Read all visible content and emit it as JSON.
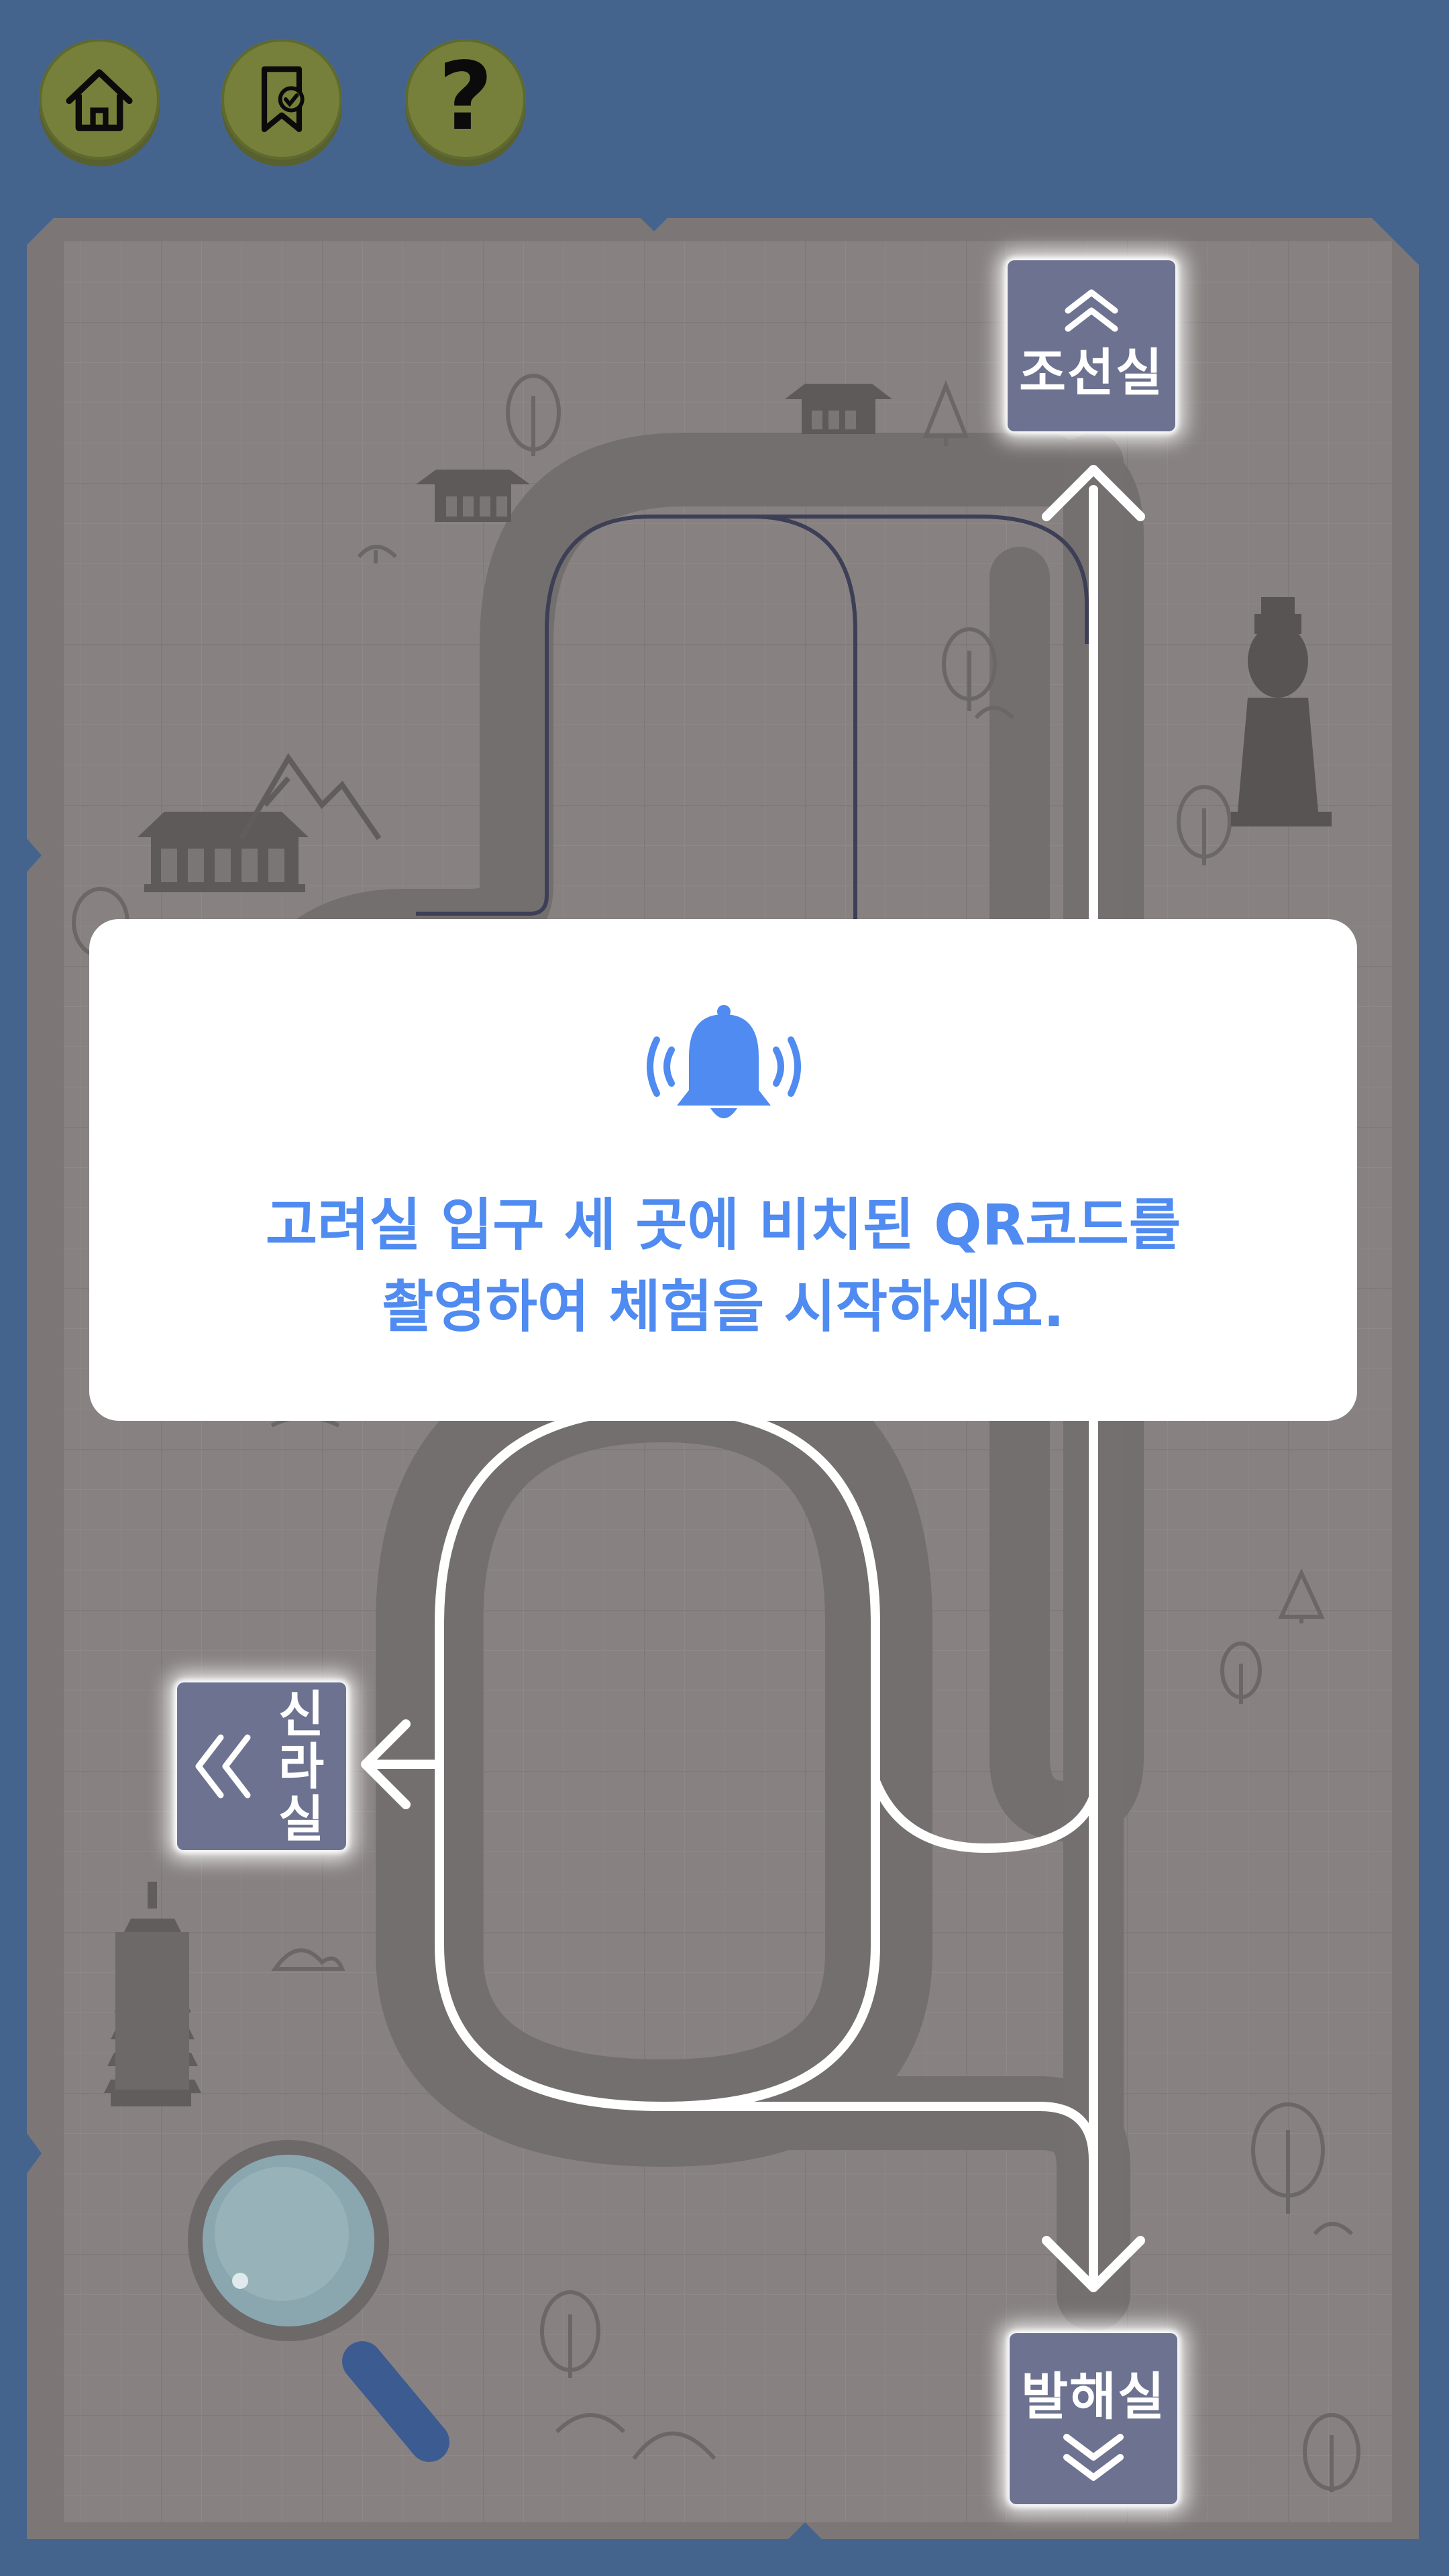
{
  "toolbar": {
    "home_icon": "home-icon",
    "bookmark_icon": "bookmark-check-icon",
    "help_label": "?"
  },
  "map": {
    "rooms": {
      "joseon": "조선실",
      "balhae": "발해실",
      "silla": "신라실"
    },
    "icons": [
      "hanok-icon",
      "tree-icon",
      "pagoda-icon",
      "statue-icon",
      "magnifier-icon",
      "mountain-icon"
    ]
  },
  "modal": {
    "icon": "bell-ringing-icon",
    "line1": "고려실 입구 세 곳에 비치된 QR코드를",
    "line2": "촬영하여 체험을 시작하세요."
  },
  "colors": {
    "background": "#45648d",
    "map_paper": "#868180",
    "road": "#757070",
    "button_olive": "#77803a",
    "room_badge": "#6c7290",
    "modal_text": "#4f8bf0"
  }
}
